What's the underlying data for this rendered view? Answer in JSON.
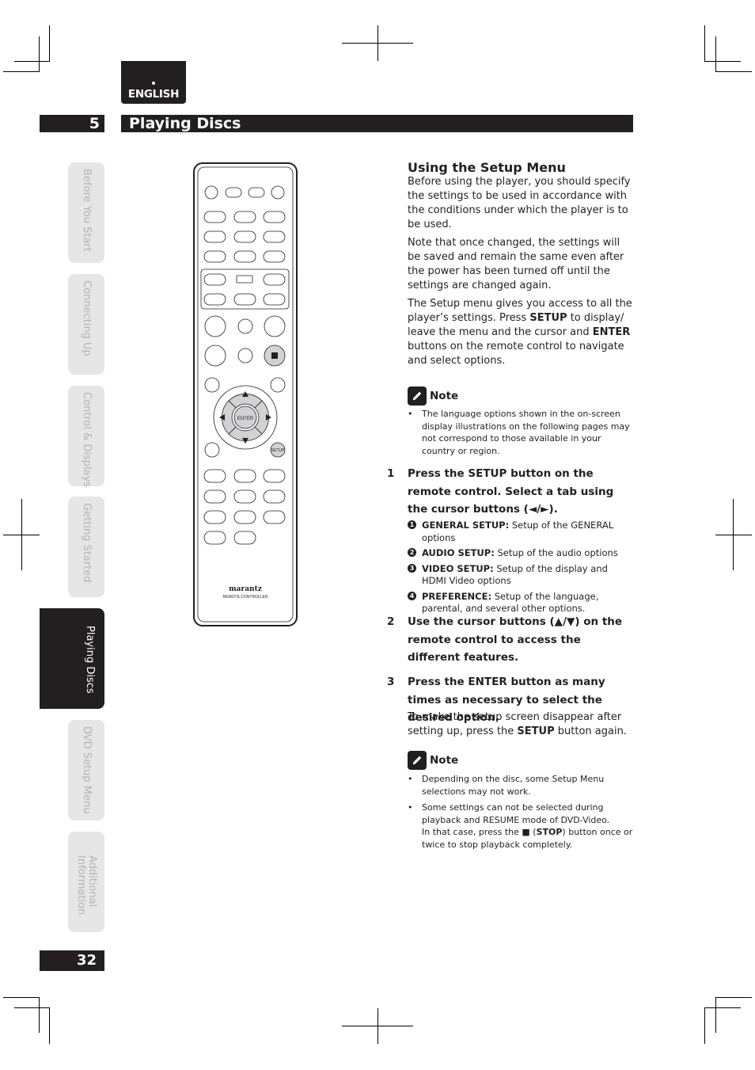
{
  "language_tab": {
    "label": "ENGLISH"
  },
  "chapter": {
    "number": "5",
    "title": "Playing Discs"
  },
  "side_tabs": [
    {
      "label": "Before You Start",
      "active": false
    },
    {
      "label": "Connecting Up",
      "active": false
    },
    {
      "label": "Control & Displays",
      "active": false
    },
    {
      "label": "Getting Started",
      "active": false
    },
    {
      "label": "Playing Discs",
      "active": true
    },
    {
      "label": "DVD Setup Menu",
      "active": false
    },
    {
      "label": "Additional\nInformation",
      "active": false
    }
  ],
  "page_number": "32",
  "remote": {
    "enter_label": "ENTER",
    "setup_label": "SETUP",
    "brand": "marantz",
    "subtitle": "REMOTE CONTROLLER",
    "icons": [
      "up-arrow-icon",
      "down-arrow-icon",
      "left-arrow-icon",
      "right-arrow-icon",
      "stop-icon"
    ]
  },
  "section": {
    "title": "Using the Setup Menu",
    "paragraphs": [
      "Before using the player, you should specify the settings to be used in accordance with the conditions under which the player is to be used.",
      "Note that once changed, the settings will be saved and remain the same even after the power has been turned off until the settings are changed again."
    ],
    "para3": {
      "part1": "The Setup menu gives you access to all the player’s settings. Press ",
      "bold1": "SETUP",
      "part2": " to display/ leave the menu and the cursor and ",
      "bold2": "ENTER",
      "part3": " buttons on the remote control to navigate and select options."
    }
  },
  "note1": {
    "heading": "Note",
    "items": [
      "The language options shown in the on-screen display illustrations on the following pages may not correspond to those available in your country or region."
    ]
  },
  "steps": [
    {
      "num": "1",
      "text": "Press the SETUP button on the remote control. Select a tab using the cursor buttons (◄/►)."
    },
    {
      "num": "2",
      "text": "Use the cursor buttons (▲/▼) on the remote control to access the different features."
    },
    {
      "num": "3",
      "text": "Press the ENTER button as many times as necessary to select the desired option."
    }
  ],
  "tabs_list": [
    {
      "n": "1",
      "label": "GENERAL SETUP:",
      "desc": "Setup of the GENERAL options"
    },
    {
      "n": "2",
      "label": "AUDIO SETUP:",
      "desc": "Setup of the audio options"
    },
    {
      "n": "3",
      "label": "VIDEO SETUP:",
      "desc": "Setup of the display and HDMI Video options"
    },
    {
      "n": "4",
      "label": "PREFERENCE:",
      "desc": "Setup of the language, parental, and several other options."
    }
  ],
  "step3_followup": {
    "part1": "To make the setup screen disappear after setting up, press the ",
    "bold": "SETUP",
    "part2": " button again."
  },
  "note2": {
    "heading": "Note",
    "item1": "Depending on the disc, some Setup Menu selections may not work.",
    "item2": {
      "line1": "Some settings can not be selected during playback and RESUME mode of DVD-Video.",
      "part1": "In that case, press the ",
      "symbol": "■",
      "open": " (",
      "bold": "STOP",
      "part2": ") button once or twice to stop playback completely."
    }
  }
}
